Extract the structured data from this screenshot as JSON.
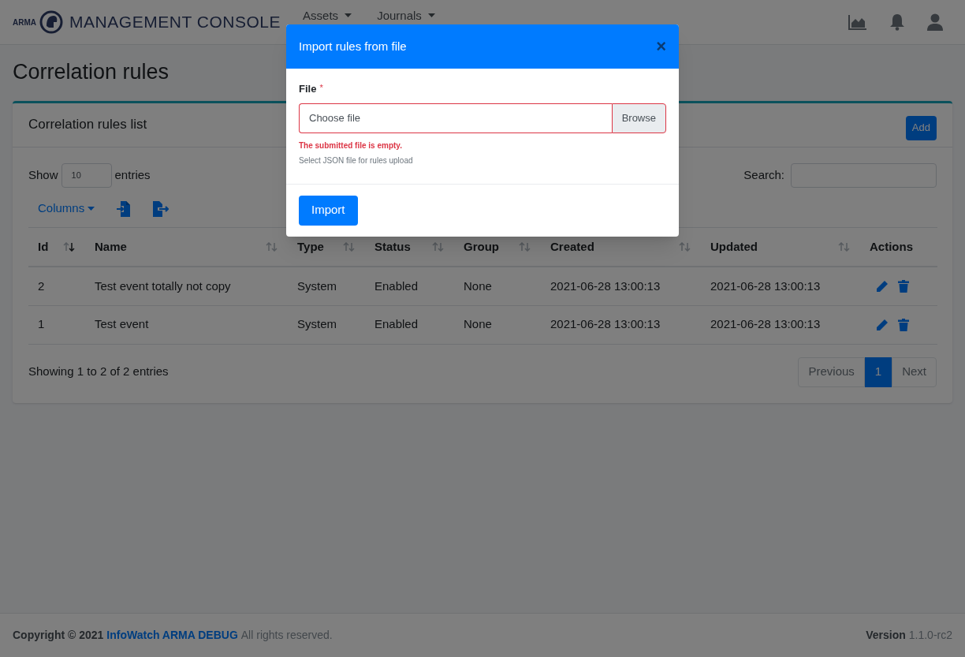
{
  "navbar": {
    "logo_small": "ARMA",
    "logo_title": "MANAGEMENT CONSOLE",
    "menus": [
      {
        "label": "Assets"
      },
      {
        "label": "Journals"
      }
    ]
  },
  "page_title": "Correlation rules",
  "card": {
    "title": "Correlation rules list",
    "add_button": "Add",
    "length": {
      "before": "Show",
      "value": "10",
      "after": "entries"
    },
    "search": {
      "label": "Search:"
    },
    "columns_button": "Columns",
    "columns": [
      {
        "label": "Id",
        "sorted": true
      },
      {
        "label": "Name",
        "sorted": false
      },
      {
        "label": "Type",
        "sorted": false
      },
      {
        "label": "Status",
        "sorted": false
      },
      {
        "label": "Group",
        "sorted": false
      },
      {
        "label": "Created",
        "sorted": false
      },
      {
        "label": "Updated",
        "sorted": false
      },
      {
        "label": "Actions"
      }
    ],
    "rows": [
      [
        "2",
        "Test event totally not copy",
        "System",
        "Enabled",
        "None",
        "2021-06-28 13:00:13",
        "2021-06-28 13:00:13"
      ],
      [
        "1",
        "Test event",
        "System",
        "Enabled",
        "None",
        "2021-06-28 13:00:13",
        "2021-06-28 13:00:13"
      ]
    ],
    "info": "Showing 1 to 2 of 2 entries",
    "pagination": [
      {
        "label": "Previous",
        "selected": false
      },
      {
        "label": "1",
        "selected": true
      },
      {
        "label": "Next",
        "selected": false
      }
    ]
  },
  "footer": {
    "copyright": "Copyright © 2021",
    "link": "InfoWatch ARMA DEBUG",
    "rights": "All rights reserved.",
    "version_label": "Version",
    "version": "1.1.0-rc2"
  },
  "modal": {
    "title": "Import rules from file",
    "close": "×",
    "field_label": "File",
    "required_mark": "*",
    "placeholder": "Choose file",
    "browse": "Browse",
    "error": "The submitted file is empty.",
    "help": "Select JSON file for rules upload",
    "submit": "Import"
  }
}
